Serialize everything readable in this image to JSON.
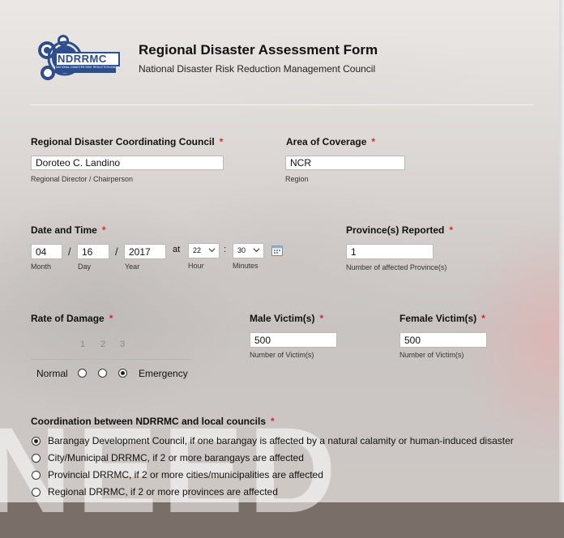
{
  "header": {
    "logo_text": "NDRRMC",
    "logo_tagline": "NATIONAL DISASTER RISK REDUCTION AND MANAGEMENT COUNCIL",
    "title": "Regional Disaster Assessment Form",
    "subtitle": "National Disaster Risk Reduction Management Council"
  },
  "background_word": "NEED",
  "coordinating_council": {
    "label": "Regional Disaster Coordinating Council",
    "required_mark": "*",
    "value": "Doroteo C. Landino",
    "sublabel": "Regional Director / Chairperson"
  },
  "area_of_coverage": {
    "label": "Area of Coverage",
    "required_mark": "*",
    "value": "NCR",
    "sublabel": "Region"
  },
  "date_time": {
    "label": "Date and Time",
    "required_mark": "*",
    "month": "04",
    "day": "16",
    "year": "2017",
    "separator": "/",
    "at_label": "at",
    "hour": "22",
    "minutes": "30",
    "colon": ":",
    "month_label": "Month",
    "day_label": "Day",
    "year_label": "Year",
    "hour_label": "Hour",
    "minutes_label": "Minutes"
  },
  "provinces": {
    "label": "Province(s) Reported",
    "required_mark": "*",
    "value": "1",
    "sublabel": "Number of affected Province(s)"
  },
  "rate_of_damage": {
    "label": "Rate of Damage",
    "required_mark": "*",
    "scale": [
      "1",
      "2",
      "3"
    ],
    "low_label": "Normal",
    "high_label": "Emergency",
    "selected": 3
  },
  "male_victims": {
    "label": "Male Victim(s)",
    "required_mark": "*",
    "value": "500",
    "sublabel": "Number of Victim(s)"
  },
  "female_victims": {
    "label": "Female Victim(s)",
    "required_mark": "*",
    "value": "500",
    "sublabel": "Number of Victim(s)"
  },
  "coordination": {
    "label": "Coordination between NDRRMC and local councils",
    "required_mark": "*",
    "options": [
      "Barangay Development Council, if one barangay is affected by a natural calamity or human-induced disaster",
      "City/Municipal DRRMC, if 2 or more barangays are affected",
      "Provincial DRRMC, if 2 or more cities/municipalities are affected",
      "Regional DRRMC, if 2 or more provinces are affected"
    ],
    "selected_index": 0
  },
  "colors": {
    "required": "#e0232b",
    "logo_blue": "#2c4e8c"
  }
}
